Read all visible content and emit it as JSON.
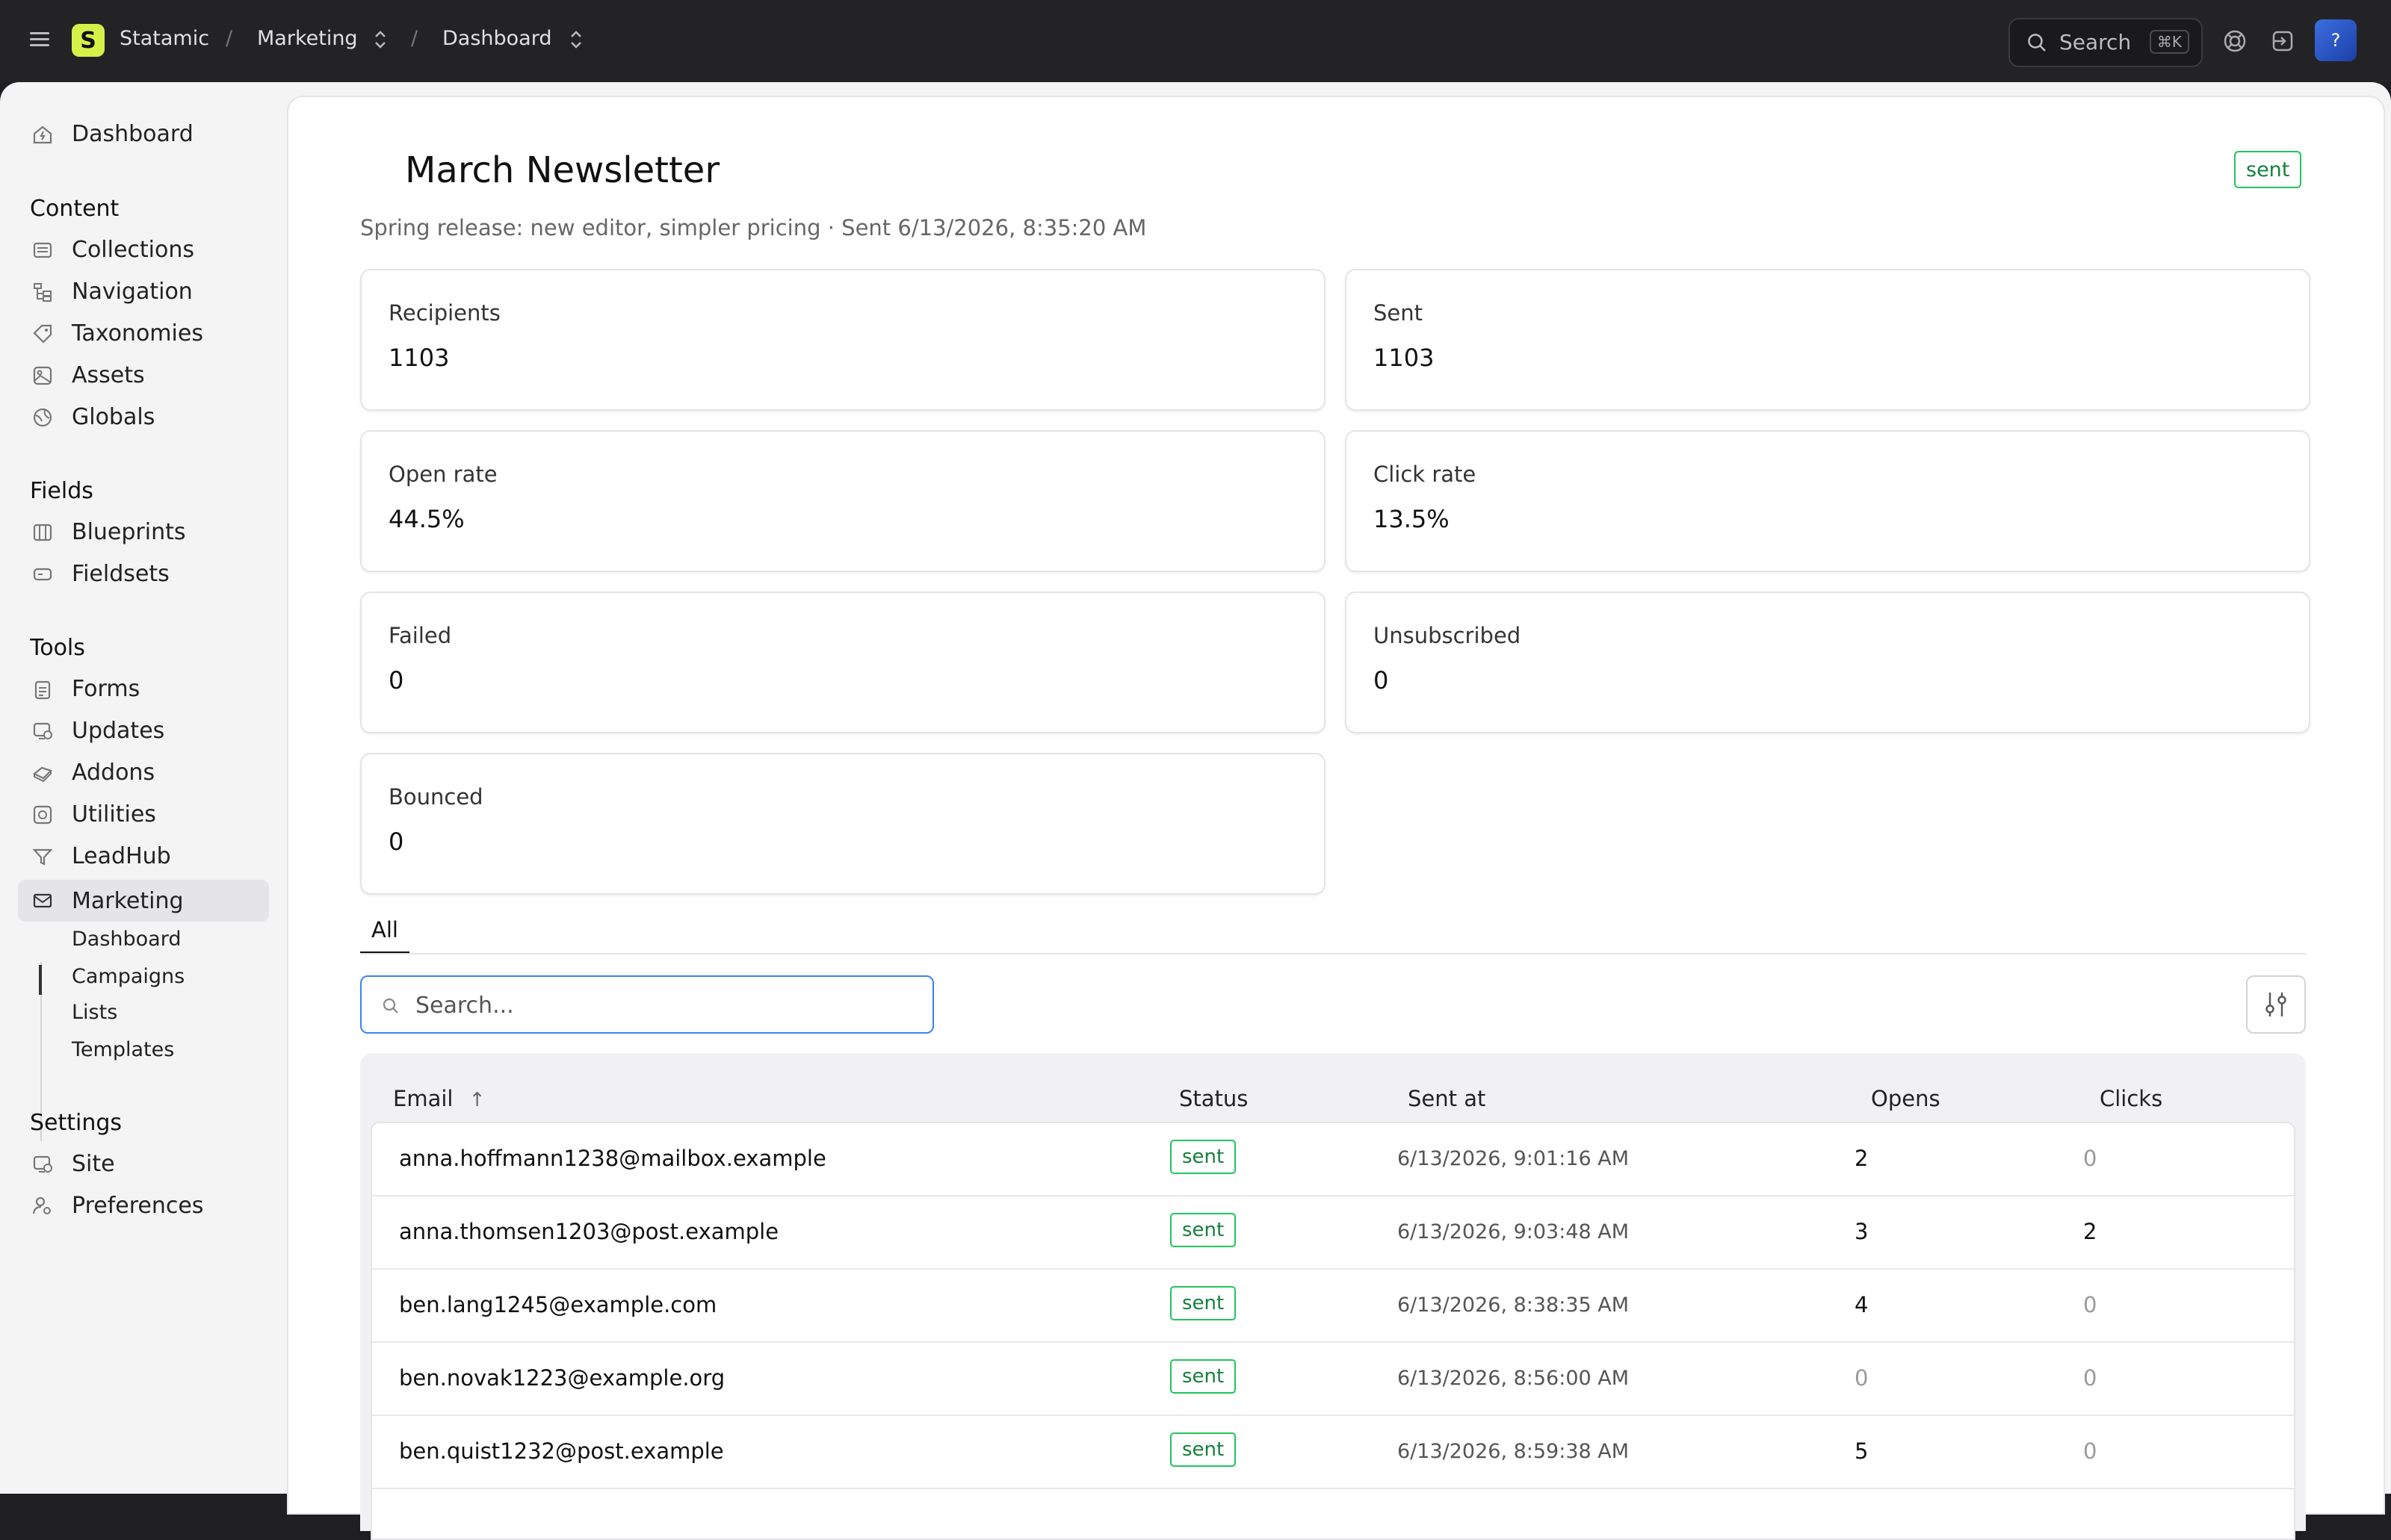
{
  "topbar": {
    "app": "Statamic",
    "logo_letter": "S",
    "crumb_site": "Marketing",
    "crumb_page": "Dashboard",
    "separator": "/",
    "search_label": "Search",
    "search_kbd": "⌘K",
    "avatar_initial": "?"
  },
  "sidebar": {
    "dashboard": "Dashboard",
    "content_head": "Content",
    "collections": "Collections",
    "navigation": "Navigation",
    "taxonomies": "Taxonomies",
    "assets": "Assets",
    "globals": "Globals",
    "fields_head": "Fields",
    "blueprints": "Blueprints",
    "fieldsets": "Fieldsets",
    "tools_head": "Tools",
    "forms": "Forms",
    "updates": "Updates",
    "addons": "Addons",
    "utilities": "Utilities",
    "leadhub": "LeadHub",
    "marketing": "Marketing",
    "sub_dashboard": "Dashboard",
    "sub_campaigns": "Campaigns",
    "sub_lists": "Lists",
    "sub_templates": "Templates",
    "settings_head": "Settings",
    "site": "Site",
    "preferences": "Preferences"
  },
  "campaign": {
    "title": "March Newsletter",
    "status": "sent",
    "subtitle": "Spring release: new editor, simpler pricing · Sent 6/13/2026, 8:35:20 AM"
  },
  "stats": [
    {
      "label": "Recipients",
      "value": "1103"
    },
    {
      "label": "Sent",
      "value": "1103"
    },
    {
      "label": "Open rate",
      "value": "44.5%"
    },
    {
      "label": "Click rate",
      "value": "13.5%"
    },
    {
      "label": "Failed",
      "value": "0"
    },
    {
      "label": "Unsubscribed",
      "value": "0"
    },
    {
      "label": "Bounced",
      "value": "0"
    }
  ],
  "tabs": {
    "all": "All"
  },
  "search": {
    "placeholder": "Search..."
  },
  "table": {
    "headers": {
      "email": "Email",
      "sort": "↑",
      "status": "Status",
      "sent_at": "Sent at",
      "opens": "Opens",
      "clicks": "Clicks"
    },
    "rows": [
      {
        "email": "anna.hoffmann1238@mailbox.example",
        "status": "sent",
        "sent_at": "6/13/2026, 9:01:16 AM",
        "opens": "2",
        "clicks": "0"
      },
      {
        "email": "anna.thomsen1203@post.example",
        "status": "sent",
        "sent_at": "6/13/2026, 9:03:48 AM",
        "opens": "3",
        "clicks": "2"
      },
      {
        "email": "ben.lang1245@example.com",
        "status": "sent",
        "sent_at": "6/13/2026, 8:38:35 AM",
        "opens": "4",
        "clicks": "0"
      },
      {
        "email": "ben.novak1223@example.org",
        "status": "sent",
        "sent_at": "6/13/2026, 8:56:00 AM",
        "opens": "0",
        "clicks": "0"
      },
      {
        "email": "ben.quist1232@post.example",
        "status": "sent",
        "sent_at": "6/13/2026, 8:59:38 AM",
        "opens": "5",
        "clicks": "0"
      }
    ]
  }
}
